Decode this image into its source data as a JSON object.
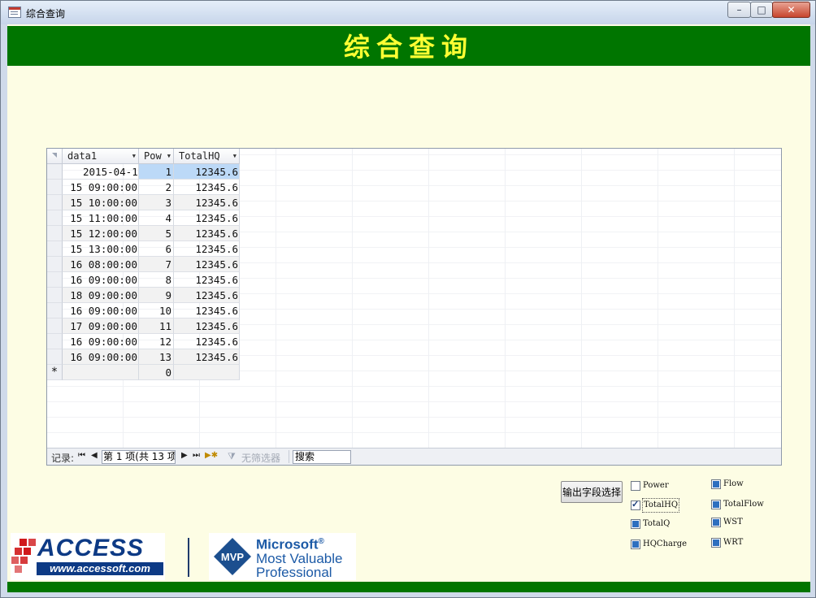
{
  "window": {
    "title": "综合查询",
    "min_glyph": "–",
    "max_glyph": "□",
    "close_glyph": "✕"
  },
  "form": {
    "header_title": "综合查询",
    "header_bg": "#007500",
    "header_fg": "#ffff33",
    "form_bg": "#fdfde4"
  },
  "datasheet": {
    "columns": [
      {
        "label": "data1"
      },
      {
        "label": "Pow"
      },
      {
        "label": "TotalHQ"
      }
    ],
    "rows": [
      {
        "date": "2015-04-1",
        "pow": "1",
        "total": "12345.6"
      },
      {
        "date": "15 09:00:00",
        "pow": "2",
        "total": "12345.6"
      },
      {
        "date": "15 10:00:00",
        "pow": "3",
        "total": "12345.6"
      },
      {
        "date": "15 11:00:00",
        "pow": "4",
        "total": "12345.6"
      },
      {
        "date": "15 12:00:00",
        "pow": "5",
        "total": "12345.6"
      },
      {
        "date": "15 13:00:00",
        "pow": "6",
        "total": "12345.6"
      },
      {
        "date": "16 08:00:00",
        "pow": "7",
        "total": "12345.6"
      },
      {
        "date": "16 09:00:00",
        "pow": "8",
        "total": "12345.6"
      },
      {
        "date": "18 09:00:00",
        "pow": "9",
        "total": "12345.6"
      },
      {
        "date": "16 09:00:00",
        "pow": "10",
        "total": "12345.6"
      },
      {
        "date": "17 09:00:00",
        "pow": "11",
        "total": "12345.6"
      },
      {
        "date": "16 09:00:00",
        "pow": "12",
        "total": "12345.6"
      },
      {
        "date": "16 09:00:00",
        "pow": "13",
        "total": "12345.6"
      }
    ],
    "new_row": {
      "marker": "*",
      "date": "",
      "pow": "0",
      "total": ""
    },
    "navigation": {
      "label": "记录:",
      "first": "⏮",
      "prev": "◀",
      "next": "▶",
      "last": "⏭",
      "new": "▶✱",
      "record_text": "第 1 项(共 13 项",
      "filter_icon": "⧩",
      "filter_label": "无筛选器",
      "search_placeholder": "搜索"
    }
  },
  "controls": {
    "field_select_button": "输出字段选择",
    "checkboxes": [
      {
        "label": "Power",
        "state": "unchecked"
      },
      {
        "label": "TotalHQ",
        "state": "checked"
      },
      {
        "label": "TotalQ",
        "state": "filled"
      },
      {
        "label": "HQCharge",
        "state": "filled"
      },
      {
        "label": "Flow",
        "state": "filled"
      },
      {
        "label": "TotalFlow",
        "state": "filled"
      },
      {
        "label": "WST",
        "state": "filled"
      },
      {
        "label": "WRT",
        "state": "filled"
      }
    ]
  },
  "logos": {
    "access_word": "ACCESS",
    "access_url": "www.accessoft.com",
    "mvp_badge": "MVP",
    "mvp_line1": "Microsoft",
    "mvp_reg": "®",
    "mvp_line2": "Most Valuable",
    "mvp_line3": "Professional"
  }
}
